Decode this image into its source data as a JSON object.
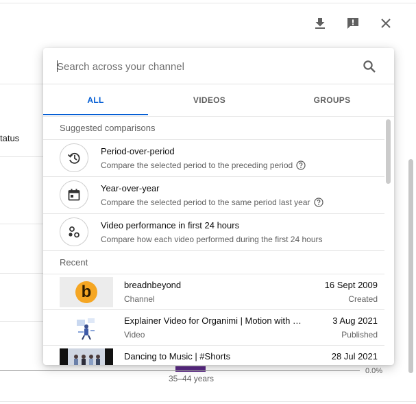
{
  "background": {
    "column_header": "tatus",
    "axis_label": "35–44 years",
    "axis_value": "0.0%"
  },
  "toolbar": {
    "download_icon": "download-icon",
    "feedback_icon": "feedback-icon",
    "close_icon": "close-icon"
  },
  "popup": {
    "search": {
      "placeholder": "Search across your channel",
      "value": "",
      "icon": "search-icon"
    },
    "tabs": [
      {
        "label": "ALL",
        "active": true
      },
      {
        "label": "VIDEOS",
        "active": false
      },
      {
        "label": "GROUPS",
        "active": false
      }
    ],
    "suggested_header": "Suggested comparisons",
    "suggested": [
      {
        "icon": "history-icon",
        "title": "Period-over-period",
        "desc": "Compare the selected period to the preceding period"
      },
      {
        "icon": "calendar-icon",
        "title": "Year-over-year",
        "desc": "Compare the selected period to the same period last year"
      },
      {
        "icon": "scatter-dots-icon",
        "title": "Video performance in first 24 hours",
        "desc": "Compare how each video performed during the first 24 hours"
      }
    ],
    "recent_header": "Recent",
    "recent": [
      {
        "title": "breadnbeyond",
        "type": "Channel",
        "date": "16 Sept 2009",
        "status": "Created",
        "thumb_letter": "b"
      },
      {
        "title": "Explainer Video for Organimi | Motion with Character Animation",
        "type": "Video",
        "date": "3 Aug 2021",
        "status": "Published"
      },
      {
        "title": "Dancing to Music | #Shorts",
        "type": "",
        "date": "28 Jul 2021",
        "status": ""
      }
    ]
  },
  "colors": {
    "accent": "#065fd4",
    "channel_thumb_bg": "#f5a623",
    "chart_bar": "#5b2a86"
  }
}
